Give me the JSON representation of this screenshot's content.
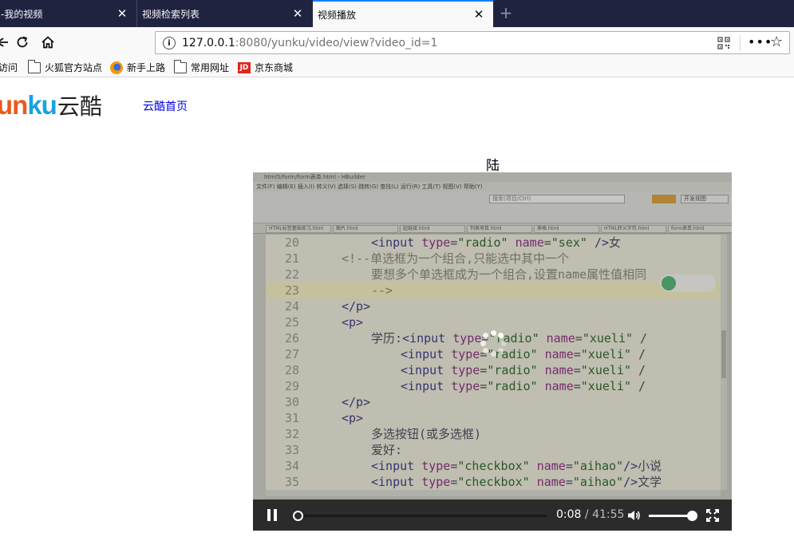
{
  "tabs": [
    {
      "title": "-我的视频",
      "active": false
    },
    {
      "title": "视频检索列表",
      "active": false
    },
    {
      "title": "视频播放",
      "active": true
    }
  ],
  "new_tab_icon": "plus-icon",
  "address_bar": {
    "url_host": "127.0.0.1",
    "url_rest": ":8080/yunku/video/view?video_id=1"
  },
  "bookmarks": [
    {
      "label": "访问",
      "icon": "none"
    },
    {
      "label": "火狐官方站点",
      "icon": "folder-icon"
    },
    {
      "label": "新手上路",
      "icon": "firefox-icon"
    },
    {
      "label": "常用网址",
      "icon": "folder-icon"
    },
    {
      "label": "京东商城",
      "icon": "jd-icon"
    }
  ],
  "site": {
    "logo_part1": "y",
    "logo_part1b": "un",
    "logo_part2": "ku",
    "logo_cn": "云酷",
    "home_link": "云酷首页"
  },
  "video": {
    "title": "陆",
    "current_time": "0:08",
    "separator": "/",
    "duration": "41:55",
    "progress_fraction": 0.0032,
    "volume_fraction": 1.0,
    "state": "loading"
  },
  "ide_screen": {
    "window_title": "html5/form/form表单.html - HBuilder",
    "menu": "文件(F)   编辑(E)   插入(I)   转义(V)   选择(S)   跳转(G)   查找(L)   运行(R)   工具(T)   视图(V)   帮助(Y)",
    "search_placeholder": "搜索(项目/Ctrl)",
    "view_select": "开发视图",
    "file_tabs": [
      "HTML标签基础练习.html",
      "图片.html",
      "超链接.html",
      "列表项目.html",
      "表格.html",
      "HTML转义字符.html",
      "form表单.html"
    ],
    "code_lines": [
      {
        "n": "20",
        "indent": 3,
        "parts": [
          [
            "tag",
            "<input "
          ],
          [
            "attr",
            "type"
          ],
          [
            "plain",
            "="
          ],
          [
            "val",
            "\"radio\""
          ],
          [
            "plain",
            " "
          ],
          [
            "attr",
            "name"
          ],
          [
            "plain",
            "="
          ],
          [
            "val",
            "\"sex\""
          ],
          [
            "tag",
            " />"
          ],
          [
            "plain",
            "女"
          ]
        ]
      },
      {
        "n": "21",
        "indent": 2,
        "parts": [
          [
            "cmt",
            "<!--单选框为一个组合,只能选中其中一个"
          ]
        ]
      },
      {
        "n": "22",
        "indent": 3,
        "parts": [
          [
            "cmt",
            "要想多个单选框成为一个组合,设置name属性值相同"
          ]
        ]
      },
      {
        "n": "23",
        "indent": 3,
        "parts": [
          [
            "cmt",
            "-->"
          ]
        ]
      },
      {
        "n": "24",
        "indent": 2,
        "parts": [
          [
            "tag",
            "</p>"
          ]
        ]
      },
      {
        "n": "25",
        "indent": 2,
        "parts": [
          [
            "tag",
            "<p>"
          ]
        ]
      },
      {
        "n": "26",
        "indent": 3,
        "parts": [
          [
            "plain",
            "学历:"
          ],
          [
            "tag",
            "<input "
          ],
          [
            "attr",
            "type"
          ],
          [
            "plain",
            "="
          ],
          [
            "val",
            "\"radio\""
          ],
          [
            "plain",
            " "
          ],
          [
            "attr",
            "name"
          ],
          [
            "plain",
            "="
          ],
          [
            "val",
            "\"xueli\""
          ],
          [
            "plain",
            "  /"
          ]
        ]
      },
      {
        "n": "27",
        "indent": 4,
        "parts": [
          [
            "tag",
            "<input "
          ],
          [
            "attr",
            "type"
          ],
          [
            "plain",
            "="
          ],
          [
            "val",
            "\"radio\""
          ],
          [
            "plain",
            " "
          ],
          [
            "attr",
            "name"
          ],
          [
            "plain",
            "="
          ],
          [
            "val",
            "\"xueli\""
          ],
          [
            "plain",
            "  /"
          ]
        ]
      },
      {
        "n": "28",
        "indent": 4,
        "parts": [
          [
            "tag",
            "<input "
          ],
          [
            "attr",
            "type"
          ],
          [
            "plain",
            "="
          ],
          [
            "val",
            "\"radio\""
          ],
          [
            "plain",
            " "
          ],
          [
            "attr",
            "name"
          ],
          [
            "plain",
            "="
          ],
          [
            "val",
            "\"xueli\""
          ],
          [
            "plain",
            "  /"
          ]
        ]
      },
      {
        "n": "29",
        "indent": 4,
        "parts": [
          [
            "tag",
            "<input "
          ],
          [
            "attr",
            "type"
          ],
          [
            "plain",
            "="
          ],
          [
            "val",
            "\"radio\""
          ],
          [
            "plain",
            " "
          ],
          [
            "attr",
            "name"
          ],
          [
            "plain",
            "="
          ],
          [
            "val",
            "\"xueli\""
          ],
          [
            "plain",
            "  /"
          ]
        ]
      },
      {
        "n": "30",
        "indent": 2,
        "parts": [
          [
            "tag",
            "</p>"
          ]
        ]
      },
      {
        "n": "31",
        "indent": 2,
        "parts": [
          [
            "tag",
            "<p>"
          ]
        ]
      },
      {
        "n": "32",
        "indent": 3,
        "parts": [
          [
            "plain",
            "多选按钮(或多选框)"
          ]
        ]
      },
      {
        "n": "33",
        "indent": 3,
        "parts": [
          [
            "plain",
            "爱好:"
          ]
        ]
      },
      {
        "n": "34",
        "indent": 3,
        "parts": [
          [
            "tag",
            "<input "
          ],
          [
            "attr",
            "type"
          ],
          [
            "plain",
            "="
          ],
          [
            "val",
            "\"checkbox\""
          ],
          [
            "plain",
            " "
          ],
          [
            "attr",
            "name"
          ],
          [
            "plain",
            "="
          ],
          [
            "val",
            "\"aihao\""
          ],
          [
            "tag",
            "/>"
          ],
          [
            "plain",
            "小说"
          ]
        ]
      },
      {
        "n": "35",
        "indent": 3,
        "parts": [
          [
            "tag",
            "<input "
          ],
          [
            "attr",
            "type"
          ],
          [
            "plain",
            "="
          ],
          [
            "val",
            "\"checkbox\""
          ],
          [
            "plain",
            " "
          ],
          [
            "attr",
            "name"
          ],
          [
            "plain",
            "="
          ],
          [
            "val",
            "\"aihao\""
          ],
          [
            "tag",
            "/>"
          ],
          [
            "plain",
            "文学"
          ]
        ]
      }
    ],
    "current_line": "23"
  },
  "colors": {
    "tab_strip": "#202340",
    "active_tab_accent": "#0a84ff",
    "logo_orange": "#e85a1e",
    "logo_blue": "#1aa2e0",
    "link": "#0000ee",
    "player_bar": "#2b2b2b"
  },
  "icons": {
    "back": "back-arrow-icon",
    "reload": "reload-icon",
    "home": "home-icon",
    "info": "info-icon",
    "qr": "qr-code-icon",
    "more": "page-actions-icon",
    "bookmark": "star-icon",
    "pause": "pause-icon",
    "volume": "volume-icon",
    "fullscreen": "fullscreen-icon",
    "loading": "loading-spinner-icon"
  }
}
